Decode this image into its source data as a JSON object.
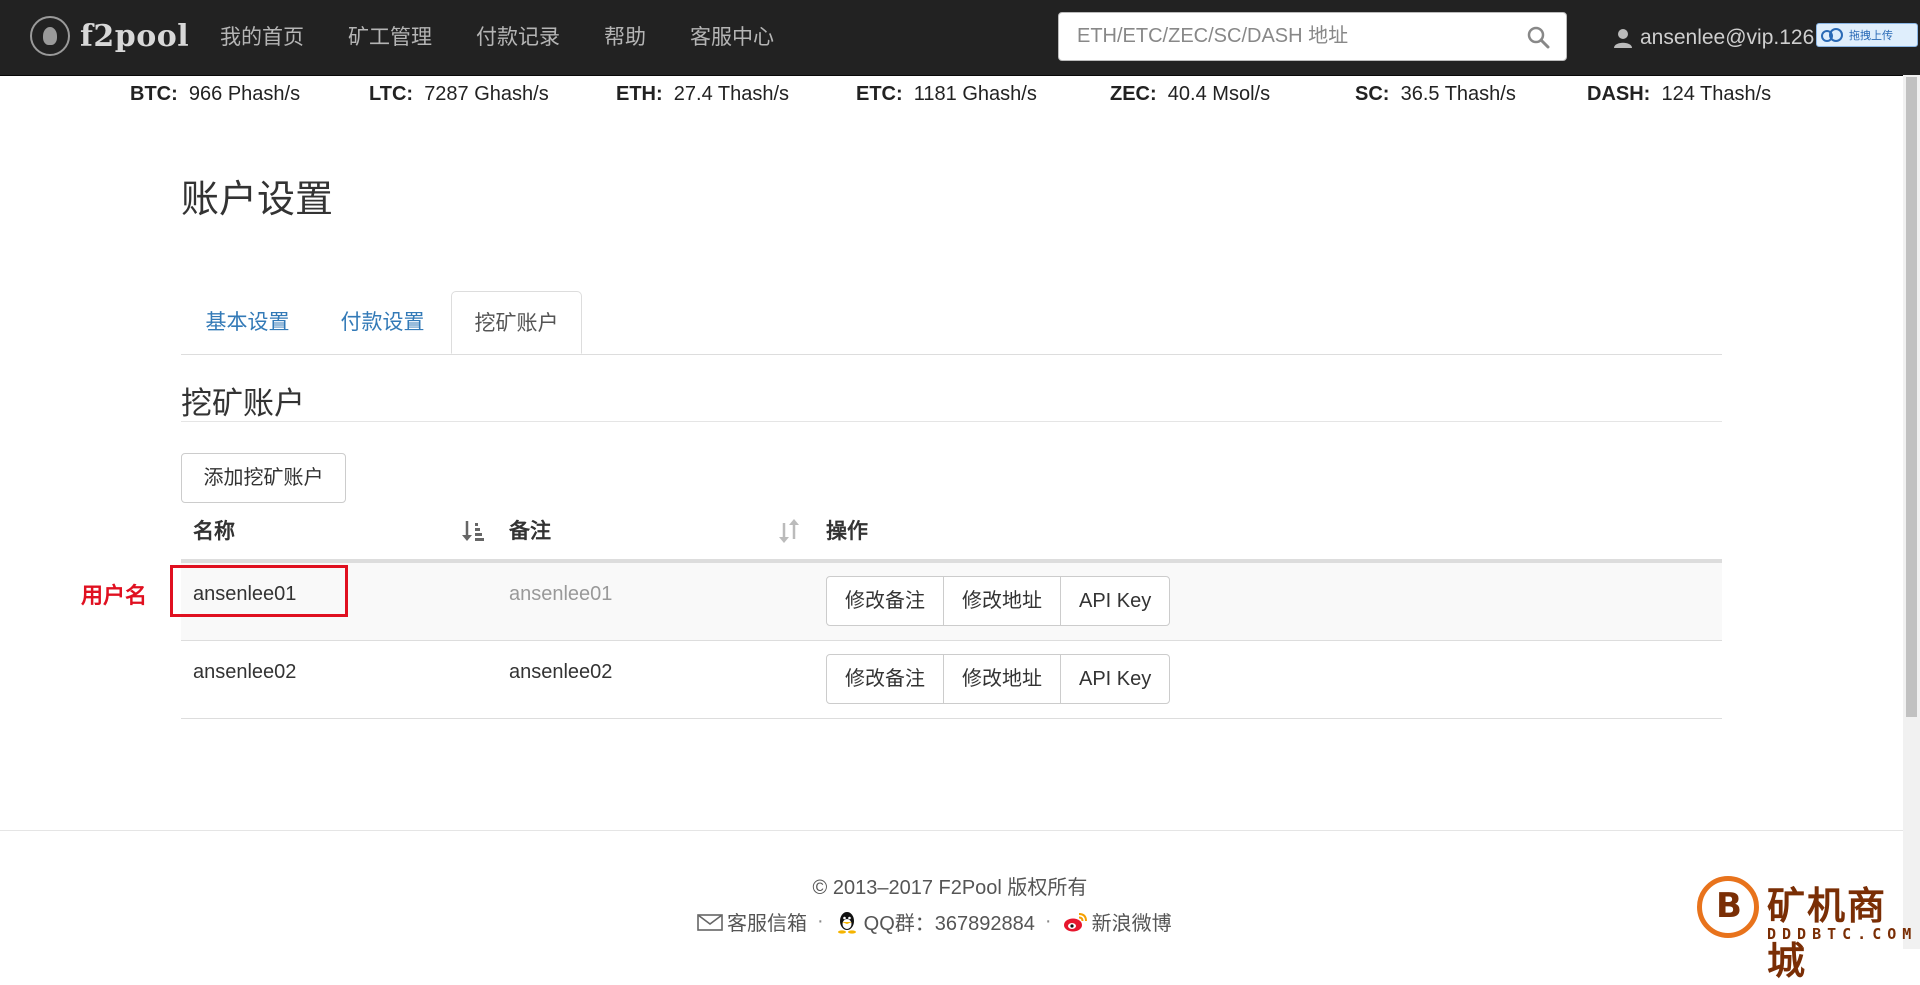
{
  "navbar": {
    "brand": "f2pool",
    "links": [
      "我的首页",
      "矿工管理",
      "付款记录",
      "帮助",
      "客服中心"
    ],
    "search_placeholder": "ETH/ETC/ZEC/SC/DASH 地址",
    "user": "ansenlee@vip.126",
    "upload_widget_label": "拖拽上传"
  },
  "hashrates": [
    {
      "coin": "BTC:",
      "rate": "966 Phash/s"
    },
    {
      "coin": "LTC:",
      "rate": "7287 Ghash/s"
    },
    {
      "coin": "ETH:",
      "rate": "27.4 Thash/s"
    },
    {
      "coin": "ETC:",
      "rate": "1181 Ghash/s"
    },
    {
      "coin": "ZEC:",
      "rate": "40.4 Msol/s"
    },
    {
      "coin": "SC:",
      "rate": "36.5 Thash/s"
    },
    {
      "coin": "DASH:",
      "rate": "124 Thash/s"
    }
  ],
  "page_title": "账户设置",
  "tabs": [
    "基本设置",
    "付款设置",
    "挖矿账户"
  ],
  "active_tab": "挖矿账户",
  "section_title": "挖矿账户",
  "add_button": "添加挖矿账户",
  "table": {
    "headers": [
      "名称",
      "备注",
      "操作"
    ],
    "rows": [
      {
        "name": "ansenlee01",
        "note": "ansenlee01",
        "actions": [
          "修改备注",
          "修改地址",
          "API Key"
        ]
      },
      {
        "name": "ansenlee02",
        "note": "ansenlee02",
        "actions": [
          "修改备注",
          "修改地址",
          "API Key"
        ]
      }
    ]
  },
  "annotation": "用户名",
  "footer": {
    "copyright": "© 2013–2017 F2Pool 版权所有",
    "email": "客服信箱",
    "qq": "QQ群：367892884",
    "weibo": "新浪微博",
    "separator": "·"
  },
  "watermark": {
    "title": "矿机商城",
    "sub": "DDDBTC.COM"
  },
  "colors": {
    "navbar_bg": "#222222",
    "link": "#337ab7",
    "annotation": "#e01020",
    "watermark": "#7a2e05"
  }
}
